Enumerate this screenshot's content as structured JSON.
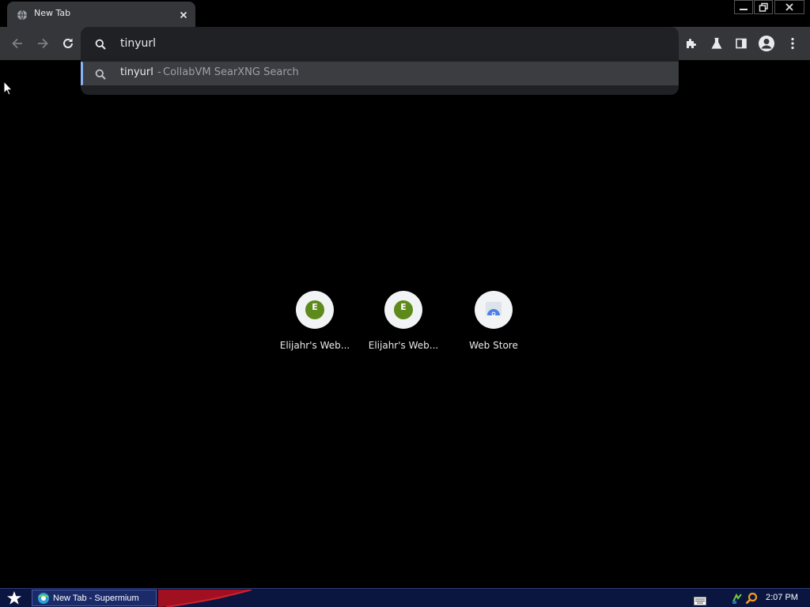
{
  "browser": {
    "tab_title": "New Tab",
    "omnibox_value": "tinyurl",
    "suggestion": {
      "query": "tinyurl",
      "separator": "-",
      "engine": "CollabVM SearXNG Search"
    }
  },
  "shortcuts": [
    {
      "label": "Elijahr's Web...",
      "icon_letter": "E"
    },
    {
      "label": "Elijahr's Web...",
      "icon_letter": "E"
    },
    {
      "label": "Web Store"
    }
  ],
  "taskbar": {
    "task_label": "New Tab - Supermium",
    "clock": "2:07 PM"
  },
  "colors": {
    "accent": "#8ab4f8",
    "toolbar": "#35363a",
    "omnibox": "#202124",
    "taskbar": "#0a1640",
    "shortcut_badge": "#5d8a1a"
  }
}
